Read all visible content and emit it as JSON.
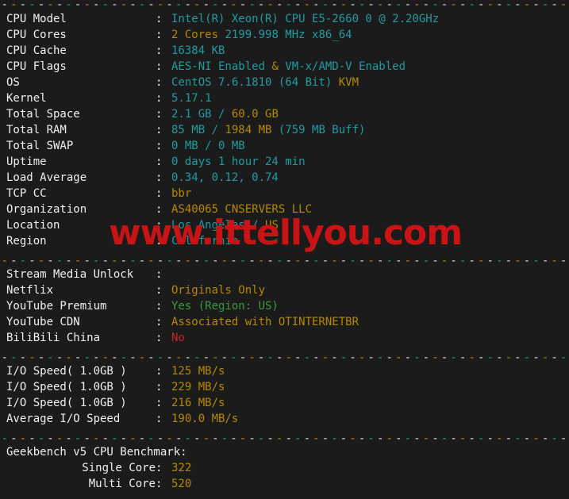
{
  "terminal": {
    "background": "#1b1b1b",
    "palette": {
      "label": "#f0f0f0",
      "cyan": "#1f9ca0",
      "gold": "#b58900",
      "green": "#3a9a3a",
      "red": "#cc2222",
      "watermark": "#c81414"
    },
    "separator_char": "-"
  },
  "watermark": {
    "text": "www.ittellyou.com"
  },
  "sections": [
    {
      "name": "system-info",
      "rows": [
        {
          "label": "CPU Model",
          "colon": ":",
          "parts": [
            {
              "text": "Intel(R) Xeon(R) CPU E5-2660 0 @ 2.20GHz",
              "color": "cyan"
            }
          ]
        },
        {
          "label": "CPU Cores",
          "colon": ":",
          "parts": [
            {
              "text": "2 Cores ",
              "color": "gold"
            },
            {
              "text": "2199.998 MHz x86_64",
              "color": "cyan"
            }
          ]
        },
        {
          "label": "CPU Cache",
          "colon": ":",
          "parts": [
            {
              "text": "16384 KB",
              "color": "cyan"
            }
          ]
        },
        {
          "label": "CPU Flags",
          "colon": ":",
          "parts": [
            {
              "text": "AES-NI Enabled ",
              "color": "cyan"
            },
            {
              "text": "& ",
              "color": "gold"
            },
            {
              "text": "VM-x/AMD-V Enabled",
              "color": "cyan"
            }
          ]
        },
        {
          "label": "OS",
          "colon": ":",
          "parts": [
            {
              "text": "CentOS 7.6.1810 (64 Bit) ",
              "color": "cyan"
            },
            {
              "text": "KVM",
              "color": "gold"
            }
          ]
        },
        {
          "label": "Kernel",
          "colon": ":",
          "parts": [
            {
              "text": "5.17.1",
              "color": "cyan"
            }
          ]
        },
        {
          "label": "Total Space",
          "colon": ":",
          "parts": [
            {
              "text": "2.1 GB ",
              "color": "cyan"
            },
            {
              "text": "/ ",
              "color": "cyan"
            },
            {
              "text": "60.0 GB",
              "color": "gold"
            }
          ]
        },
        {
          "label": "Total RAM",
          "colon": ":",
          "parts": [
            {
              "text": "85 MB / ",
              "color": "cyan"
            },
            {
              "text": "1984 MB ",
              "color": "gold"
            },
            {
              "text": "(759 MB Buff)",
              "color": "cyan"
            }
          ]
        },
        {
          "label": "Total SWAP",
          "colon": ":",
          "parts": [
            {
              "text": "0 MB / 0 MB",
              "color": "cyan"
            }
          ]
        },
        {
          "label": "Uptime",
          "colon": ":",
          "parts": [
            {
              "text": "0 days 1 hour 24 min",
              "color": "cyan"
            }
          ]
        },
        {
          "label": "Load Average",
          "colon": ":",
          "parts": [
            {
              "text": "0.34, 0.12, 0.74",
              "color": "cyan"
            }
          ]
        },
        {
          "label": "TCP CC",
          "colon": ":",
          "parts": [
            {
              "text": "bbr",
              "color": "gold"
            }
          ]
        },
        {
          "label": "Organization",
          "colon": ":",
          "parts": [
            {
              "text": "AS40065 CNSERVERS LLC",
              "color": "gold"
            }
          ]
        },
        {
          "label": "Location",
          "colon": ":",
          "parts": [
            {
              "text": "Los Angeles ",
              "color": "cyan"
            },
            {
              "text": "/ ",
              "color": "cyan"
            },
            {
              "text": "US",
              "color": "gold"
            }
          ]
        },
        {
          "label": "Region",
          "colon": ":",
          "parts": [
            {
              "text": "California",
              "color": "cyan"
            }
          ]
        }
      ]
    },
    {
      "name": "stream-media-unlock",
      "rows": [
        {
          "label": "Stream Media Unlock",
          "colon": ":",
          "parts": [
            {
              "text": "",
              "color": "white"
            }
          ]
        },
        {
          "label": "Netflix",
          "colon": ":",
          "parts": [
            {
              "text": "Originals Only",
              "color": "gold"
            }
          ]
        },
        {
          "label": "YouTube Premium",
          "colon": ":",
          "parts": [
            {
              "text": "Yes (Region: US)",
              "color": "green"
            }
          ]
        },
        {
          "label": "YouTube CDN",
          "colon": ":",
          "parts": [
            {
              "text": "Associated with OTINTERNETBR",
              "color": "gold"
            }
          ]
        },
        {
          "label": "BiliBili China",
          "colon": ":",
          "parts": [
            {
              "text": "No",
              "color": "red"
            }
          ]
        }
      ]
    },
    {
      "name": "io-speed",
      "rows": [
        {
          "label": "I/O Speed( 1.0GB )",
          "colon": ":",
          "parts": [
            {
              "text": "125 MB/s",
              "color": "gold"
            }
          ]
        },
        {
          "label": "I/O Speed( 1.0GB )",
          "colon": ":",
          "parts": [
            {
              "text": "229 MB/s",
              "color": "gold"
            }
          ]
        },
        {
          "label": "I/O Speed( 1.0GB )",
          "colon": ":",
          "parts": [
            {
              "text": "216 MB/s",
              "color": "gold"
            }
          ]
        },
        {
          "label": "Average I/O Speed",
          "colon": ":",
          "parts": [
            {
              "text": "190.0 MB/s",
              "color": "gold"
            }
          ]
        }
      ]
    },
    {
      "name": "geekbench",
      "heading": "Geekbench v5 CPU Benchmark:",
      "rows": [
        {
          "label": "Single Core",
          "align": "right",
          "colon": ":",
          "parts": [
            {
              "text": "322",
              "color": "gold"
            }
          ]
        },
        {
          "label": "Multi Core",
          "align": "right",
          "colon": ":",
          "parts": [
            {
              "text": "520",
              "color": "gold"
            }
          ]
        }
      ]
    }
  ]
}
